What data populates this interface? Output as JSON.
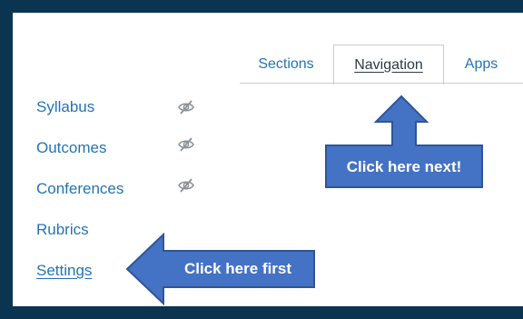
{
  "tabs": [
    {
      "label": "Sections",
      "state": "link"
    },
    {
      "label": "Navigation",
      "state": "active"
    },
    {
      "label": "Apps",
      "state": "link"
    }
  ],
  "nav": [
    {
      "label": "Syllabus",
      "hidden_icon": "eye-slash-icon"
    },
    {
      "label": "Outcomes",
      "hidden_icon": "eye-slash-icon"
    },
    {
      "label": "Conferences",
      "hidden_icon": "eye-slash-icon"
    },
    {
      "label": "Rubrics"
    },
    {
      "label": "Settings",
      "current": true
    }
  ],
  "callouts": {
    "next": "Click here next!",
    "first": "Click here first"
  },
  "colors": {
    "background": "#0b3450",
    "link": "#2474b5",
    "callout": "#4472c4",
    "callout_border": "#2f5597"
  }
}
